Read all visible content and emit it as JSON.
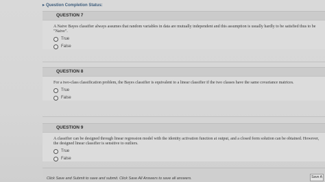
{
  "status": {
    "label": "Question Completion Status:"
  },
  "questions": [
    {
      "number": "QUESTION 7",
      "text": "A Naive Bayes classifier always assumes that random variables in data are mutually independent and this assumption is usually hardly to be satisfied thus to be \"Naive\".",
      "options": [
        "True",
        "False"
      ]
    },
    {
      "number": "QUESTION 8",
      "text": "For a two-class classification problem, the Bayes classifier is equivalent to a linear classifier if the two classes have the same covariance matrices.",
      "options": [
        "True",
        "False"
      ]
    },
    {
      "number": "QUESTION 9",
      "text": "A classifier can be designed through linear regression model with the identity activation function at output, and a closed form solution can be obtained. However, the designed linear classifier is sensitive to outliers.",
      "options": [
        "True",
        "False"
      ]
    }
  ],
  "footer": {
    "instructions": "Click Save and Submit to save and submit. Click Save All Answers to save all answers.",
    "save_button": "Save A"
  }
}
